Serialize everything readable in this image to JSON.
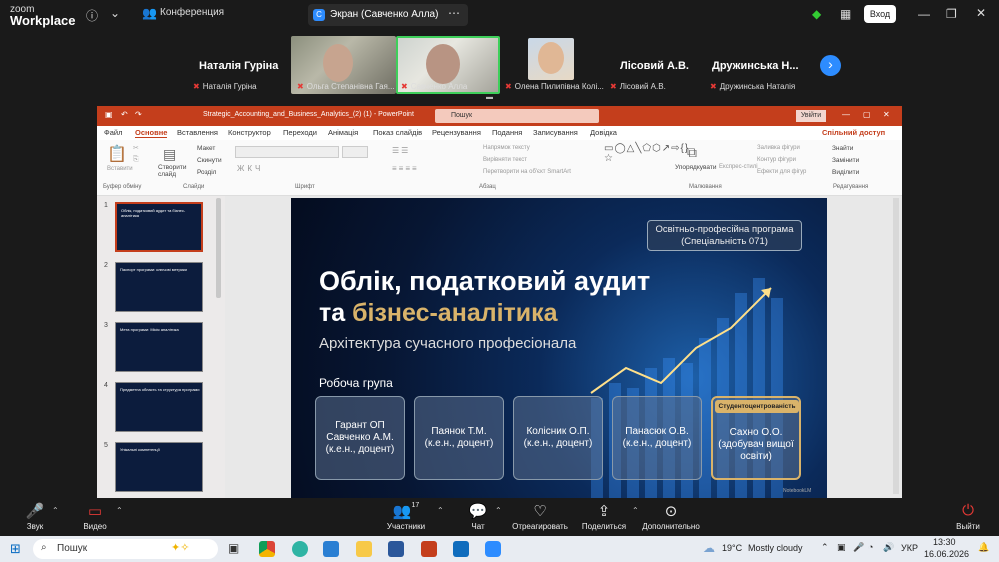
{
  "app": {
    "brand_small": "zoom",
    "brand_big": "Workplace"
  },
  "topbar": {
    "conference_label": "Конференция",
    "screen_tab": "Экран (Савченко Алла)",
    "join_label": "Вход"
  },
  "participants": {
    "text_tiles": [
      {
        "name": "Наталія Гуріна",
        "label": "Наталія Гуріна"
      },
      {
        "name": "Лісовий А.В.",
        "label": "Лісовий А.В."
      },
      {
        "name": "Дружинська Н...",
        "label": "Дружинська Наталія"
      }
    ],
    "video_tiles": [
      {
        "label": "Ольга Степанівна Гая..."
      },
      {
        "label": "Савченко Алла"
      },
      {
        "label": "Олена Пилипівна Колі..."
      }
    ]
  },
  "ppt": {
    "filename": "Strategic_Accounting_and_Business_Analytics_(2) (1)  -  PowerPoint",
    "search": "Пошук",
    "signin": "Увійти",
    "menu": [
      "Файл",
      "Основне",
      "Вставлення",
      "Конструктор",
      "Переходи",
      "Анімація",
      "Показ слайдів",
      "Рецензування",
      "Подання",
      "Записування",
      "Довідка"
    ],
    "share": "Спільний доступ",
    "ribbon": {
      "insert": "Вставити",
      "create_slide": "Створити слайд",
      "layout": "Макет",
      "reset": "Скинути",
      "section": "Розділ",
      "text_direction": "Напрямок тексту",
      "align_text": "Вирівняти текст",
      "smartart": "Перетворити на об'єкт SmartArt",
      "arrange": "Упорядкувати",
      "quick_styles": "Експрес-стилі",
      "shape_fill": "Заливка фігури",
      "shape_outline": "Контур фігури",
      "shape_effects": "Ефекти для фігур",
      "find": "Знайти",
      "replace": "Замінити",
      "select": "Виділити",
      "groups": [
        "Буфер обміну",
        "Слайди",
        "Шрифт",
        "Абзац",
        "Малювання",
        "Редагування"
      ]
    },
    "thumbnails": [
      {
        "num": "1",
        "text": "Облік, податковий аудит та бізнес-аналітика"
      },
      {
        "num": "2",
        "text": "Паспорт програми: ключові метрики"
      },
      {
        "num": "3",
        "text": "Мета програми: Місія аналітика"
      },
      {
        "num": "4",
        "text": "Предметна область та структура програми"
      },
      {
        "num": "5",
        "text": "Унікальні компетенції"
      }
    ],
    "slide": {
      "tag": "Освітньо-професійна програма (Спеціальність 071)",
      "title_line1": "Облік, податковий аудит",
      "title_line2_prefix": "та ",
      "title_line2_gold": "бізнес-аналітика",
      "subtitle": "Архітектура сучасного професіонала",
      "workgroup_label": "Робоча група",
      "cards": [
        "Гарант ОП Савченко А.М. (к.е.н., доцент)",
        "Паянок Т.М. (к.е.н., доцент)",
        "Колісник О.П. (к.е.н., доцент)",
        "Панасюк О.В. (к.е.н., доцент)",
        "Сахно О.О. (здобувач вищої освіти)"
      ],
      "badge": "Студентоцентрованість",
      "watermark": "NotebookLM"
    }
  },
  "controls": {
    "audio": "Звук",
    "video": "Видео",
    "participants": "Участники",
    "participants_count": "17",
    "chat": "Чат",
    "react": "Отреагировать",
    "share": "Поделиться",
    "more": "Дополнительно",
    "leave": "Выйти"
  },
  "taskbar": {
    "search": "Пошук",
    "weather_temp": "19°C",
    "weather_desc": "Mostly cloudy",
    "lang": "УКР",
    "time": "13:30",
    "date": "16.06.2026"
  },
  "colors": {
    "ppt_accent": "#c43e1c",
    "zoom_blue": "#2d8cff",
    "slide_gold": "#d9b36a",
    "mic_muted": "#e53935"
  }
}
